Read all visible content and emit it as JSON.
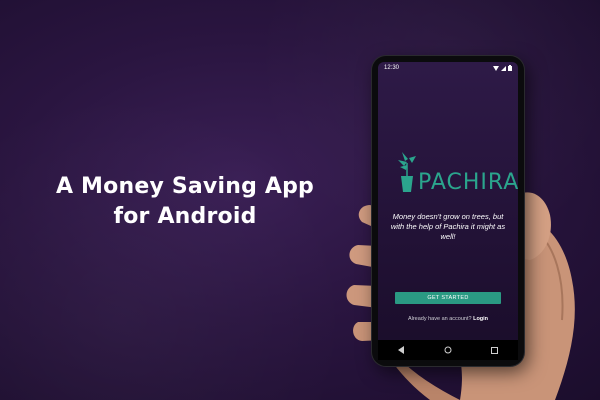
{
  "headline": {
    "line1": "A Money Saving App",
    "line2": "for Android"
  },
  "phone": {
    "status_time": "12:30",
    "status_icons": [
      "wifi-icon",
      "signal-icon",
      "battery-icon"
    ],
    "logo_text": "PACHIRA",
    "tagline": "Money doesn't grow on trees, but with the help of Pachira it might as well!",
    "cta_label": "GET STARTED",
    "login_prompt": "Already have an account?",
    "login_link": "Login",
    "nav_icons": [
      "back-icon",
      "home-icon",
      "recents-icon"
    ]
  },
  "colors": {
    "brand": "#2ba58d",
    "button": "#2a9a83",
    "background": "#2a1540"
  }
}
